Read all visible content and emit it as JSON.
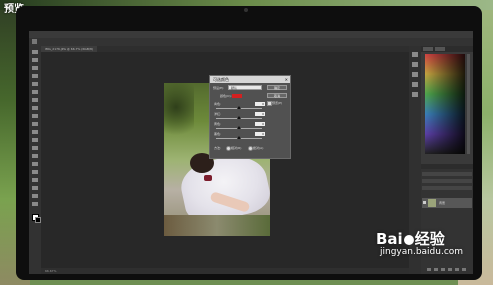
{
  "watermark": {
    "corner_text": "预览",
    "brand_left": "Bai",
    "brand_right": "经验",
    "url": "jingyan.baidu.com"
  },
  "photoshop": {
    "document_tab": "IMG_2176.JPG @ 66.7% (RGB/8)",
    "status": "66.67%",
    "dialog": {
      "title": "可选颜色",
      "preset_label": "预设(E):",
      "preset_value": "默认",
      "colors_label": "颜色(O):",
      "ok_label": "确定",
      "cancel_label": "取消",
      "preview_label": "预览(P)",
      "sliders": [
        {
          "label": "青色:",
          "value": "0",
          "pct": 0.5
        },
        {
          "label": "洋红:",
          "value": "0",
          "pct": 0.5
        },
        {
          "label": "黄色:",
          "value": "0",
          "pct": 0.5
        },
        {
          "label": "黑色:",
          "value": "0",
          "pct": 0.5
        }
      ],
      "method_label": "方法:",
      "relative_label": "相对(R)",
      "absolute_label": "绝对(A)"
    },
    "layers": {
      "background_name": "背景"
    }
  }
}
